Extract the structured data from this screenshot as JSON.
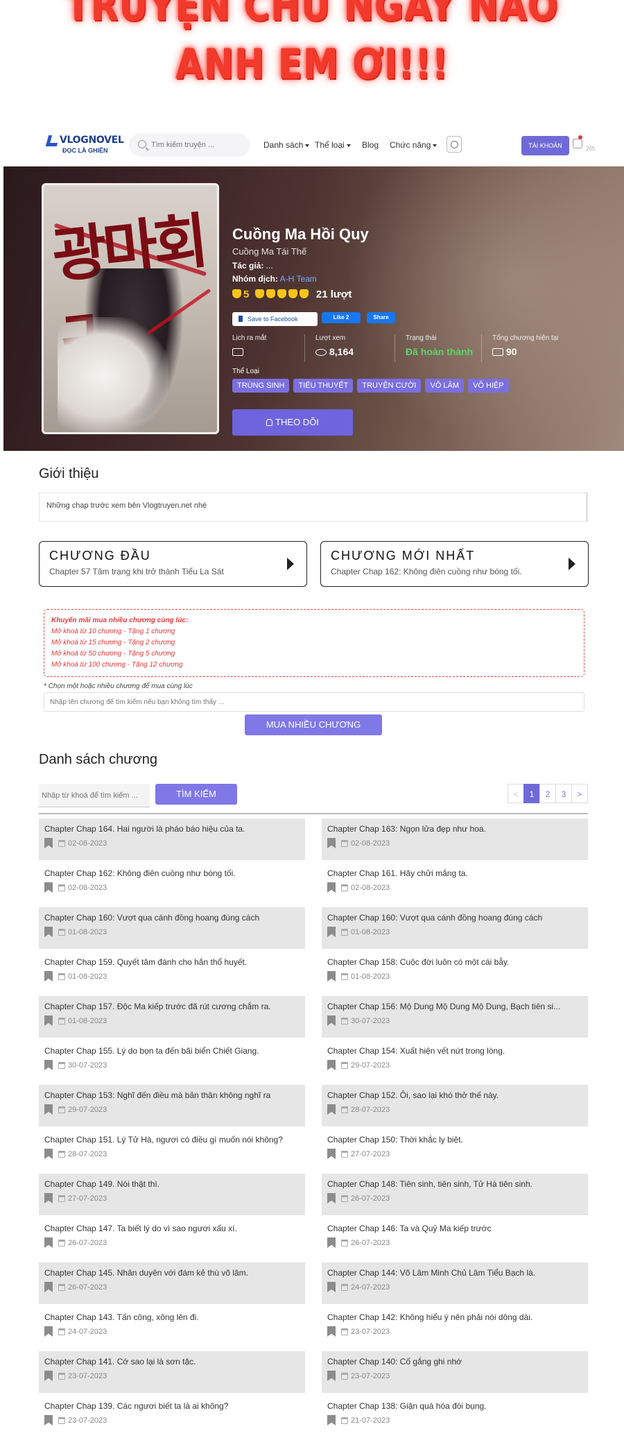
{
  "promo": {
    "line1": "TRUYỆN CHỦ NGÀY NÀO",
    "line2": "ANH EM ƠI!!!"
  },
  "nav": {
    "logo_brand": "VLOGNOVEL",
    "logo_sub": "ĐỌC LÀ GHIỀN",
    "search_placeholder": "Tìm kiếm truyện ...",
    "menu": [
      "Danh sách",
      "Thể loại",
      "Blog",
      "Chức năng"
    ],
    "account_label": "TÀI KHOẢN",
    "notif_count": "205"
  },
  "manga": {
    "title": "Cuồng Ma Hồi Quy",
    "alt_title": "Cuồng Ma Tái Thế",
    "author_label": "Tác giả:",
    "author": "...",
    "group_label": "Nhóm dịch:",
    "group": "A-H Team",
    "rating": "5",
    "rating_count": "21 lượt",
    "fb_save": "Save to Facebook",
    "fb_like": "Like 2",
    "fb_share": "Share",
    "release_label": "Lịch ra mắt",
    "views_label": "Lượt xem",
    "views": "8,164",
    "status_label": "Trạng thái",
    "status": "Đã hoàn thành",
    "total_label": "Tổng chương hiện tại",
    "total": "90",
    "genre_label": "Thể Loại",
    "genres": [
      "TRÙNG SINH",
      "TIỂU THUYẾT",
      "TRUYỆN CƯỜI",
      "VÕ LÂM",
      "VÕ HIỆP"
    ],
    "follow_label": "THEO DÕI",
    "cover_calligraphy": "광마회귀"
  },
  "intro": {
    "title": "Giới thiệu",
    "text": "Những chap trước xem bên Vlogtruyen.net nhé"
  },
  "first_chapter": {
    "head": "CHƯƠNG ĐẦU",
    "sub": "Chapter 57 Tâm trạng khi trở thành Tiểu La Sát"
  },
  "latest_chapter": {
    "head": "CHƯƠNG MỚI NHẤT",
    "sub": "Chapter Chap 162: Không điên cuồng như bóng tối."
  },
  "bulk": {
    "promo_head": "Khuyến mãi mua nhiều chương cùng lúc:",
    "promo_items": [
      "Mở khoá từ 10 chương - Tặng 1 chương",
      "Mở khoá từ 15 chương - Tặng 2 chương",
      "Mở khoá từ 50 chương - Tặng 5 chương",
      "Mở khoá từ 100 chương - Tặng 12 chương"
    ],
    "hint": "* Chọn một hoặc nhiều chương để mua cùng lúc",
    "input_placeholder": "Nhập tên chương để tìm kiếm nếu bạn không tìm thấy ...",
    "buy_label": "MUA NHIỀU CHƯƠNG"
  },
  "chapter_list": {
    "title": "Danh sách chương",
    "kw_placeholder": "Nhập từ khoá để tìm kiếm ...",
    "search_label": "TÌM KIẾM",
    "pager": [
      "<",
      "1",
      "2",
      "3",
      ">"
    ],
    "items": [
      {
        "name": "Chapter Chap 164. Hai người là pháo báo hiệu của ta.",
        "date": "02-08-2023"
      },
      {
        "name": "Chapter Chap 163: Ngọn lửa đẹp như hoa.",
        "date": "02-08-2023"
      },
      {
        "name": "Chapter Chap 162: Không điên cuồng như bóng tối.",
        "date": "02-08-2023"
      },
      {
        "name": "Chapter Chap 161. Hãy chửi mắng ta.",
        "date": "02-08-2023"
      },
      {
        "name": "Chapter Chap 160: Vượt qua cánh đồng hoang đúng cách",
        "date": "01-08-2023"
      },
      {
        "name": "Chapter Chap 160: Vượt qua cánh đồng hoang đúng cách",
        "date": "01-08-2023"
      },
      {
        "name": "Chapter Chap 159. Quyết tâm đánh cho hắn thổ huyết.",
        "date": "01-08-2023"
      },
      {
        "name": "Chapter Chap 158: Cuộc đời luôn có một cái bẫy.",
        "date": "01-08-2023"
      },
      {
        "name": "Chapter Chap 157. Độc Ma kiếp trước đã rút cương chắm ra.",
        "date": "01-08-2023"
      },
      {
        "name": "Chapter Chap 156: Mộ Dung Mộ Dung Mộ Dung, Bạch tiên si...",
        "date": "30-07-2023"
      },
      {
        "name": "Chapter Chap 155. Lý do bọn ta đến bãi biển Chiết Giang.",
        "date": "30-07-2023"
      },
      {
        "name": "Chapter Chap 154: Xuất hiện vết nứt trong lòng.",
        "date": "29-07-2023"
      },
      {
        "name": "Chapter Chap 153: Nghĩ đến điều mà bản thân không nghĩ ra",
        "date": "29-07-2023"
      },
      {
        "name": "Chapter Chap 152. Ôi, sao lại khó thở thế này.",
        "date": "28-07-2023"
      },
      {
        "name": "Chapter Chap 151. Lý Tử Hà, ngươi có điều gì muốn nói không?",
        "date": "28-07-2023"
      },
      {
        "name": "Chapter Chap 150: Thời khắc ly biệt.",
        "date": "27-07-2023"
      },
      {
        "name": "Chapter Chap 149. Nói thật thì.",
        "date": "27-07-2023"
      },
      {
        "name": "Chapter Chap 148: Tiên sinh, tiên sinh, Tử Hà tiên sinh.",
        "date": "26-07-2023"
      },
      {
        "name": "Chapter Chap 147. Ta biết lý do vì sao ngươi xấu xí.",
        "date": "26-07-2023"
      },
      {
        "name": "Chapter Chap 146: Ta và Quỷ Ma kiếp trước",
        "date": "26-07-2023"
      },
      {
        "name": "Chapter Chap 145. Nhân duyên với đám kẻ thù võ lâm.",
        "date": "26-07-2023"
      },
      {
        "name": "Chapter Chap 144: Võ Lâm Minh Chủ Lâm Tiểu Bạch là.",
        "date": "24-07-2023"
      },
      {
        "name": "Chapter Chap 143. Tấn công, xông lên đi.",
        "date": "24-07-2023"
      },
      {
        "name": "Chapter Chap 142: Không hiểu ý nên phải nói dông dài.",
        "date": "23-07-2023"
      },
      {
        "name": "Chapter Chap 141. Cớ sao lại là sơn tặc.",
        "date": "23-07-2023"
      },
      {
        "name": "Chapter Chap 140: Cố gắng ghi nhớ",
        "date": "23-07-2023"
      },
      {
        "name": "Chapter Chap 139. Các ngươi biết ta là ai không?",
        "date": "23-07-2023"
      },
      {
        "name": "Chapter Chap 138: Giận quá hóa đói bụng.",
        "date": "21-07-2023"
      }
    ]
  }
}
